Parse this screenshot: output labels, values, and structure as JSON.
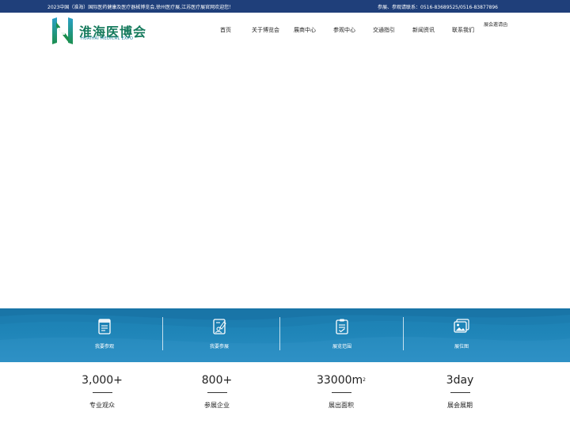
{
  "topbar": {
    "welcome": "2023中国（淮海）国际医药健康及医疗器械博览会,徐州医疗展,江苏医疗展官网欢迎您！",
    "contact": "参展、参观请联系：0516-83689525/0516-83877896"
  },
  "logo": {
    "cn": "淮海医博会",
    "en": "HUAIHAI MEDICAL EXPO"
  },
  "nav": {
    "items": [
      {
        "label": "首页"
      },
      {
        "label": "关于博览会"
      },
      {
        "label": "展商中心"
      },
      {
        "label": "参观中心"
      },
      {
        "label": "交通指引"
      },
      {
        "label": "新闻资讯"
      },
      {
        "label": "联系我们"
      }
    ],
    "invite": "展会邀请函"
  },
  "quicklinks": [
    {
      "label": "我要参观",
      "icon": "document-list-icon"
    },
    {
      "label": "我要参展",
      "icon": "registration-form-icon"
    },
    {
      "label": "展览范围",
      "icon": "checklist-icon"
    },
    {
      "label": "展位图",
      "icon": "image-gallery-icon"
    }
  ],
  "stats": [
    {
      "value": "3,000+",
      "sup": "",
      "label": "专业观众"
    },
    {
      "value": "800+",
      "sup": "",
      "label": "参展企业"
    },
    {
      "value": "33000m",
      "sup": "2",
      "label": "展出面积"
    },
    {
      "value": "3day",
      "sup": "",
      "label": "展会展期"
    }
  ],
  "colors": {
    "topbar": "#1f3f7a",
    "band": "#1f85b8",
    "logo_green": "#157a5c"
  }
}
